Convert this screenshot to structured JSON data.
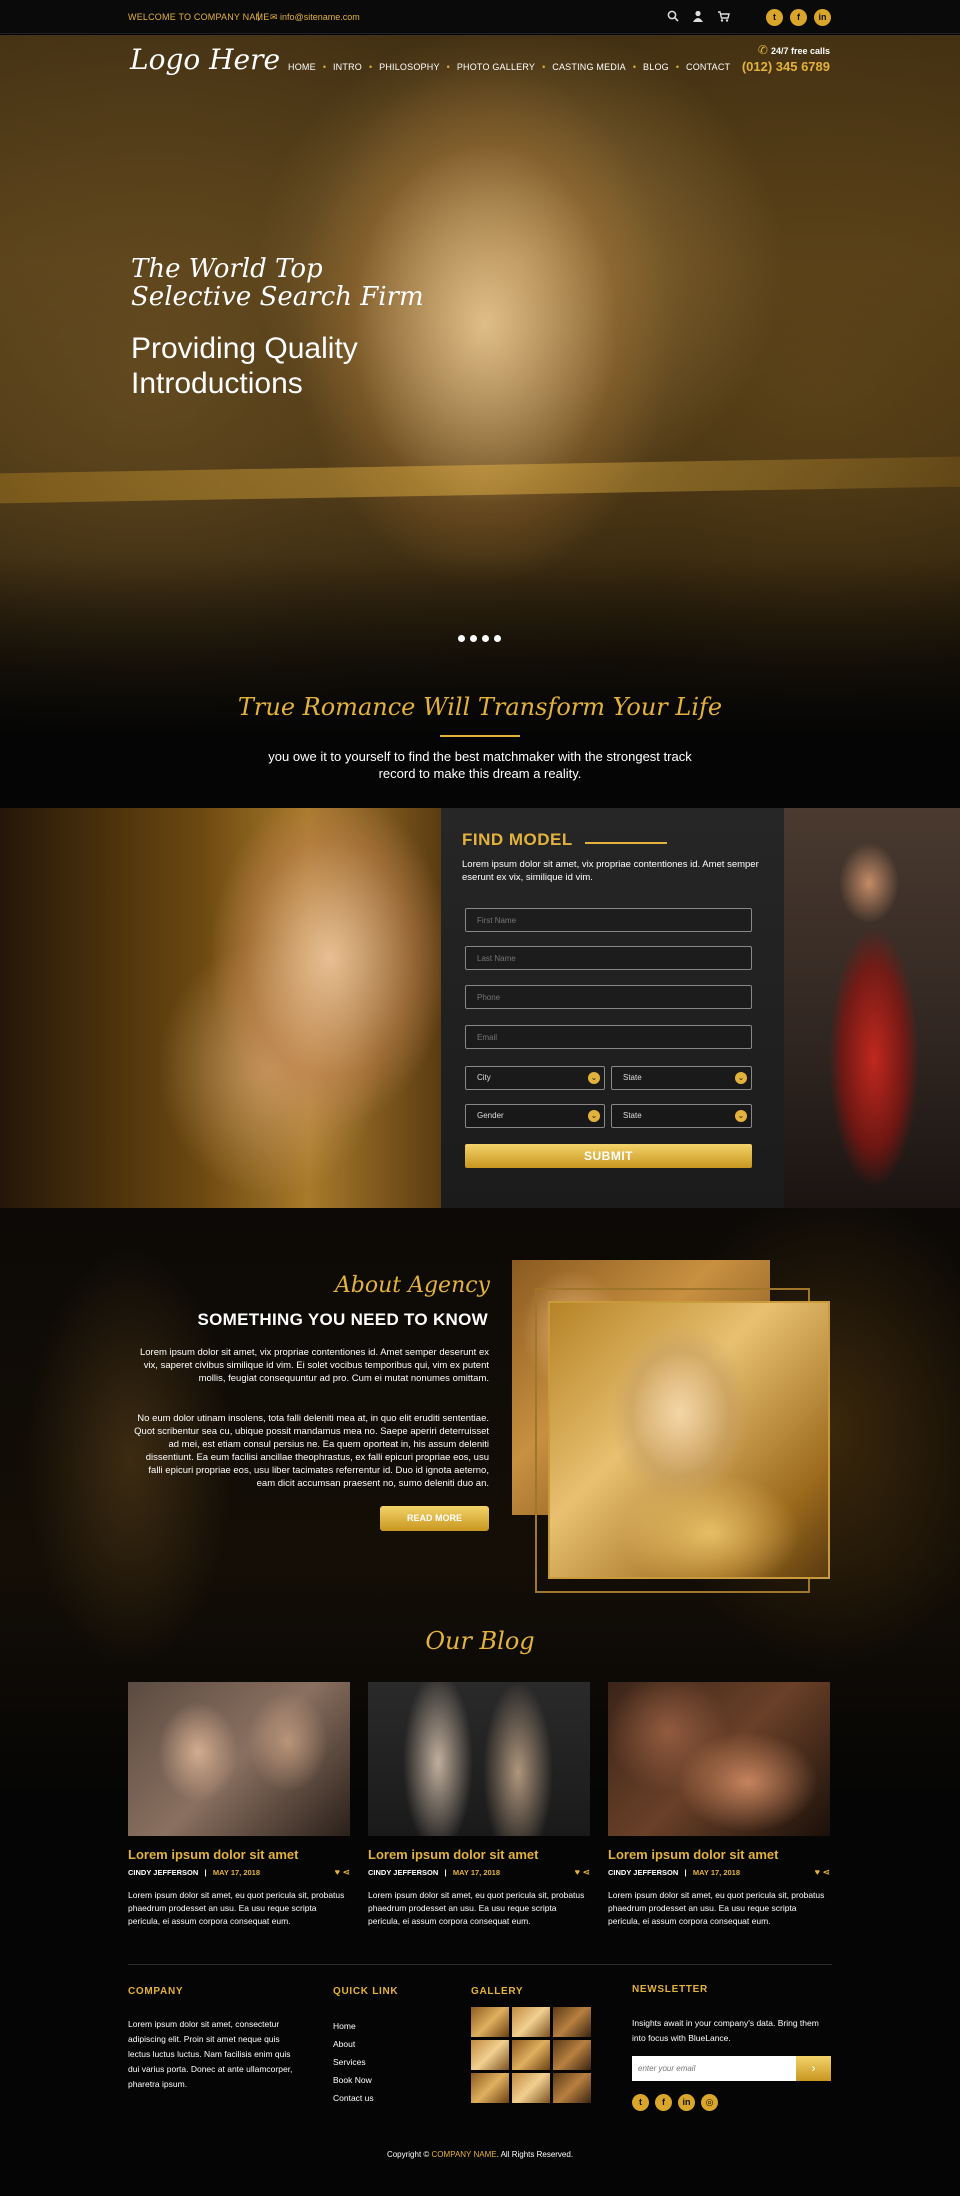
{
  "topbar": {
    "welcome": "WELCOME TO COMPANY NAME",
    "separator": "|",
    "email": "info@sitename.com",
    "icons": [
      "search-icon",
      "user-icon",
      "cart-icon"
    ],
    "social": [
      "twitter-icon",
      "facebook-icon",
      "linkedin-icon"
    ]
  },
  "header": {
    "logo": "Logo Here",
    "nav": [
      "HOME",
      "INTRO",
      "PHILOSOPHY",
      "PHOTO GALLERY",
      "CASTING MEDIA",
      "BLOG",
      "CONTACT"
    ],
    "call_label": "24/7 free calls",
    "phone": "(012) 345 6789"
  },
  "hero": {
    "title_script": "The World Top Selective Search Firm",
    "title_main": "Providing Quality Introductions",
    "slides": 4,
    "tagline": "True Romance Will Transform Your Life",
    "text": "you owe it to yourself to find the best matchmaker with the strongest track record to make this dream a reality."
  },
  "find_model": {
    "title": "FIND MODEL",
    "description": "Lorem ipsum dolor sit amet, vix propriae contentiones id. Amet semper eserunt ex vix, similique id vim.",
    "first_name": "First Name",
    "last_name": "Last Name",
    "phone": "Phone",
    "email": "Email",
    "city": "City",
    "state1": "State",
    "gender": "Gender",
    "state2": "State",
    "submit": "SUBMIT"
  },
  "about": {
    "script_title": "About Agency",
    "heading": "SOMETHING YOU NEED TO KNOW",
    "p1": "Lorem ipsum dolor sit amet, vix propriae contentiones id. Amet semper deserunt ex vix, saperet civibus similique id vim. Ei solet vocibus temporibus qui, vim ex putent mollis, feugiat consequuntur ad pro. Cum ei mutat nonumes omittam.",
    "p2": "No eum dolor utinam insolens, tota falli deleniti mea at, in quo elit eruditi sententiae. Quot scribentur sea cu, ubique possit mandamus mea no. Saepe aperiri deterruisset ad mei, est etiam consul persius ne. Ea quem oporteat in, his assum deleniti dissentiunt. Ea eum facilisi ancillae theophrastus, ex falli epicuri propriae eos, usu falli epicuri propriae eos, usu liber tacimates referrentur id. Duo id ignota aeterno, eam dicit accumsan praesent no, sumo deleniti duo an.",
    "button": "READ MORE"
  },
  "blog": {
    "title": "Our Blog",
    "posts": [
      {
        "title": "Lorem ipsum dolor sit amet",
        "author": "CINDY JEFFERSON",
        "date": "MAY 17, 2018",
        "text": "Lorem ipsum dolor sit amet, eu quot pericula sit, probatus phaedrum prodesset an usu. Ea usu reque scripta pericula, ei assum corpora consequat eum."
      },
      {
        "title": "Lorem ipsum dolor sit amet",
        "author": "CINDY JEFFERSON",
        "date": "MAY 17, 2018",
        "text": "Lorem ipsum dolor sit amet, eu quot pericula sit, probatus phaedrum prodesset an usu. Ea usu reque scripta pericula, ei assum corpora consequat eum."
      },
      {
        "title": "Lorem ipsum dolor sit amet",
        "author": "CINDY JEFFERSON",
        "date": "MAY 17, 2018",
        "text": "Lorem ipsum dolor sit amet, eu quot pericula sit, probatus phaedrum prodesset an usu. Ea usu reque scripta pericula, ei assum corpora consequat eum."
      }
    ]
  },
  "footer": {
    "company_head": "COMPANY",
    "company_text": "Lorem ipsum dolor sit amet, consectetur adipiscing elit. Proin sit amet neque quis lectus luctus luctus. Nam facilisis enim quis dui varius porta. Donec at ante ullamcorper, pharetra ipsum.",
    "quick_head": "QUICK LINK",
    "links": [
      "Home",
      "About",
      "Services",
      "Book Now",
      "Contact us"
    ],
    "gallery_head": "GALLERY",
    "news_head": "NEWSLETTER",
    "news_text": "Insights await in your company's data. Bring them into focus with BlueLance.",
    "news_placeholder": "enter your email",
    "social": [
      "twitter-icon",
      "facebook-icon",
      "linkedin-icon",
      "dribbble-icon"
    ],
    "copyright_pre": "Copyright ©",
    "copyright_name": "COMPANY NAME",
    "copyright_post": ". All Rights Reserved."
  },
  "colors": {
    "accent": "#e3b23c",
    "background": "#050505",
    "panel": "#222222"
  }
}
